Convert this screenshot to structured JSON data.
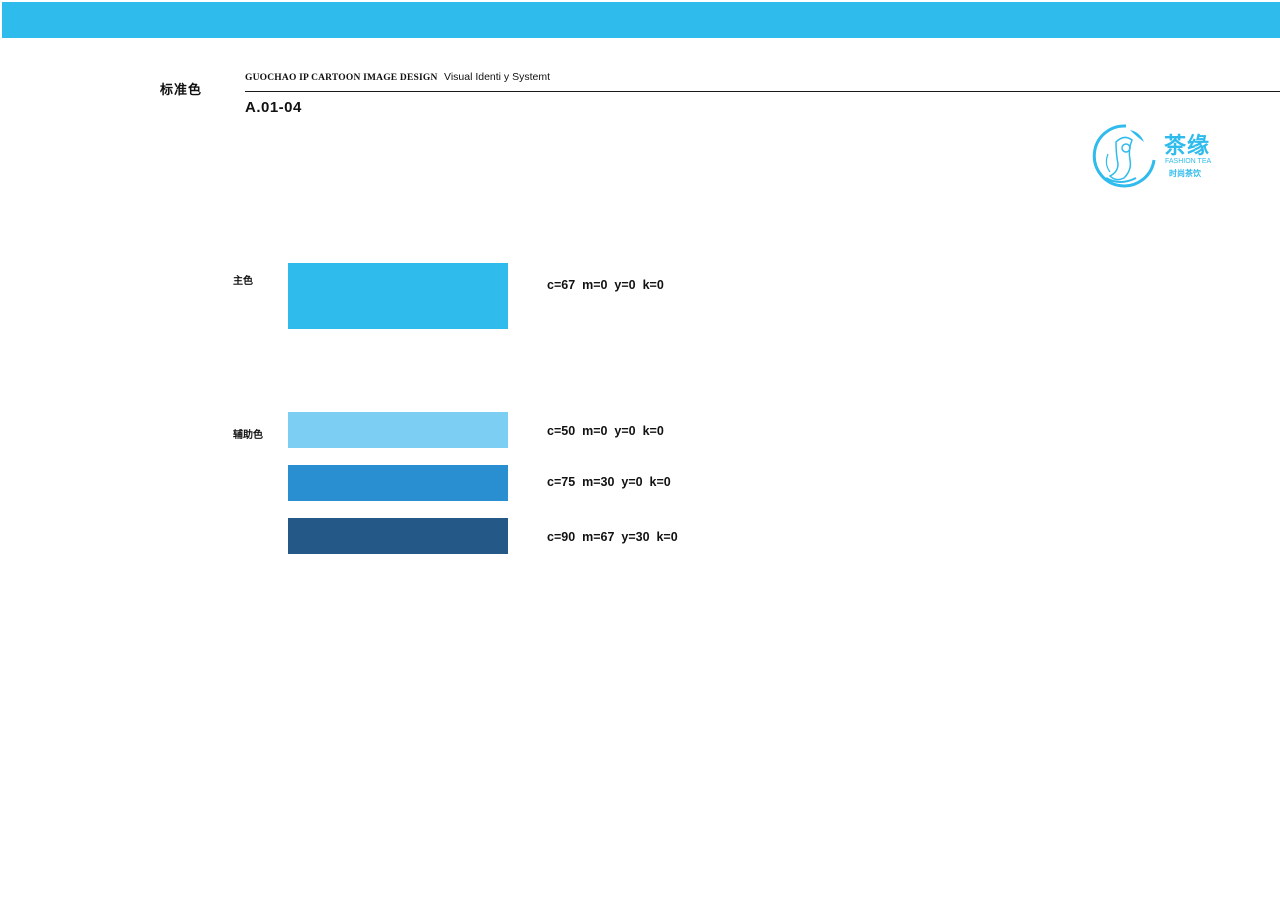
{
  "header": {
    "section_title": "标准色",
    "project_name": "GUOCHAO IP CARTOON IMAGE DESIGN",
    "system_name": "Visual Identi y Systemt",
    "page_code": "A.01-04"
  },
  "logo": {
    "title": "茶缘",
    "subtitle_en": "FASHION TEA",
    "subtitle_cn": "时尚茶饮"
  },
  "colors": {
    "top_bar": "#2fbbec",
    "primary": [
      {
        "hex": "#2fbbec",
        "cmyk": "c=67  m=0  y=0  k=0"
      }
    ],
    "secondary": [
      {
        "hex": "#7ccef3",
        "cmyk": "c=50  m=0  y=0  k=0"
      },
      {
        "hex": "#298fd0",
        "cmyk": "c=75  m=30  y=0  k=0"
      },
      {
        "hex": "#235887",
        "cmyk": "c=90  m=67  y=30  k=0"
      }
    ]
  },
  "groups": {
    "primary_label": "主色",
    "secondary_label": "辅助色"
  }
}
